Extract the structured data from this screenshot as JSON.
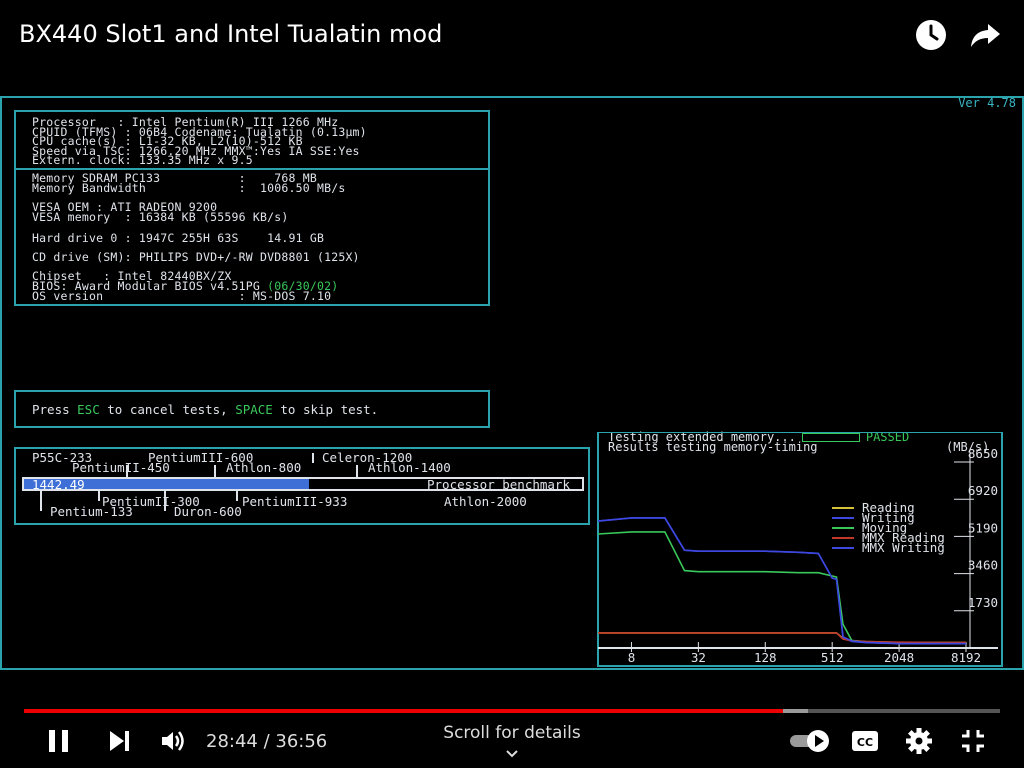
{
  "video": {
    "title": "BX440 Slot1 and Intel Tualatin mod",
    "current_time": "28:44",
    "duration": "36:56",
    "separator": " / ",
    "scroll_hint": "Scroll for details",
    "progress_played": 0.778,
    "progress_buffered": 0.803
  },
  "dos": {
    "version": "Ver 4.78",
    "sysinfo_top": [
      "Processor   : Intel Pentium(R) III 1266 MHz",
      "CPUID (TFMS) : 06B4 Codename: Tualatin (0.13μm)",
      "CPU cache(s) : L1-32 KB, L2(10)-512 KB",
      "Speed via TSC: 1266.20 MHz MMX™:Yes IA SSE:Yes",
      "Extern. clock: 133.35 MHz x 9.5"
    ],
    "sysinfo_mem": [
      "Memory SDRAM PC133           :    768 MB",
      "Memory Bandwidth             :  1006.50 MB/s"
    ],
    "vesa": [
      "VESA OEM : ATI RADEON 9200",
      "VESA memory  : 16384 KB (55596 KB/s)"
    ],
    "hdd": "Hard drive 0 : 1947C 255H 63S    14.91 GB",
    "cd": "CD drive (SM): PHILIPS DVD+/-RW DVD8801 (125X)",
    "chipset": "Chipset   : Intel 82440BX/ZX",
    "bios_prefix": "BIOS: Award Modular BIOS v4.51PG ",
    "bios_date": "(06/30/02)",
    "os": "OS version                   : MS-DOS 7.10",
    "hint_a": "Press ",
    "hint_esc": "ESC",
    "hint_b": " to cancel tests, ",
    "hint_space": "SPACE",
    "hint_c": " to skip test.",
    "bench": {
      "score": "1442.49",
      "label": "Processor benchmark",
      "score_fraction": 0.51,
      "above": [
        "P55C-233",
        "PentiumIII-600",
        "Celeron-1200",
        "PentiumII-450",
        "Athlon-800",
        "Athlon-1400"
      ],
      "below": [
        "PentiumII-300",
        "PentiumIII-933",
        "Athlon-2000",
        "Pentium-133",
        "Duron-600"
      ]
    },
    "memtest": {
      "line1": "Testing extended memory...",
      "status": "PASSED",
      "line2": "Results testing memory-timing",
      "unit": "(MB/s)"
    }
  },
  "chart_data": {
    "type": "line",
    "title": "",
    "xlabel": "",
    "ylabel": "(MB/s)",
    "x_ticks": [
      "8",
      "32",
      "128",
      "512",
      "2048",
      "8192"
    ],
    "y_ticks": [
      "8650",
      "6920",
      "5190",
      "3460",
      "1730"
    ],
    "ylim": [
      0,
      8650
    ],
    "x": [
      4,
      8,
      16,
      24,
      32,
      64,
      128,
      256,
      384,
      512,
      560,
      640,
      768,
      1024,
      2048,
      4096,
      8192
    ],
    "series": [
      {
        "name": "Reading",
        "color": "#d6c23a",
        "values": [
          700,
          700,
          700,
          700,
          700,
          700,
          700,
          700,
          700,
          700,
          700,
          450,
          350,
          300,
          260,
          250,
          250
        ]
      },
      {
        "name": "Writing",
        "color": "#3c48e0",
        "values": [
          5900,
          6050,
          6050,
          4550,
          4500,
          4500,
          4500,
          4450,
          4400,
          3250,
          3200,
          500,
          300,
          250,
          200,
          200,
          200
        ]
      },
      {
        "name": "Moving",
        "color": "#39c85a",
        "values": [
          5300,
          5400,
          5400,
          3600,
          3550,
          3550,
          3550,
          3500,
          3500,
          3350,
          3300,
          1100,
          350,
          280,
          250,
          250,
          250
        ]
      },
      {
        "name": "MMX Reading",
        "color": "#c0392b",
        "values": [
          700,
          700,
          700,
          700,
          700,
          700,
          700,
          700,
          700,
          700,
          700,
          420,
          330,
          300,
          270,
          260,
          260
        ]
      },
      {
        "name": "MMX Writing",
        "color": "#3c48e0",
        "values": [
          5900,
          6050,
          6050,
          4550,
          4500,
          4500,
          4500,
          4450,
          4400,
          3250,
          3200,
          520,
          320,
          260,
          210,
          210,
          210
        ]
      }
    ]
  }
}
